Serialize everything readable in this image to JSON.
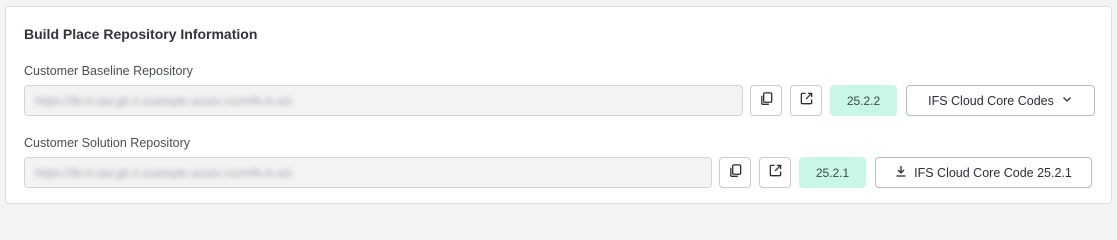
{
  "section": {
    "title": "Build Place Repository Information"
  },
  "baseline": {
    "label": "Customer Baseline Repository",
    "url": "https://ifs-b-aw.git.rt.example.azure.com/ifs-b-ws",
    "version": "25.2.2",
    "code_button_label": "IFS Cloud Core Codes",
    "code_button_icon": "chevron-down-icon"
  },
  "solution": {
    "label": "Customer Solution Repository",
    "url": "https://ifs-b-aw.git.rt.example.azure.com/ifs-b-ws",
    "version": "25.2.1",
    "code_button_label": "IFS Cloud Core Code 25.2.1",
    "code_button_icon": "download-icon"
  },
  "icons": {
    "copy": "copy-icon",
    "open_external": "external-link-icon"
  },
  "colors": {
    "version_badge_bg": "#c8f7e5"
  }
}
